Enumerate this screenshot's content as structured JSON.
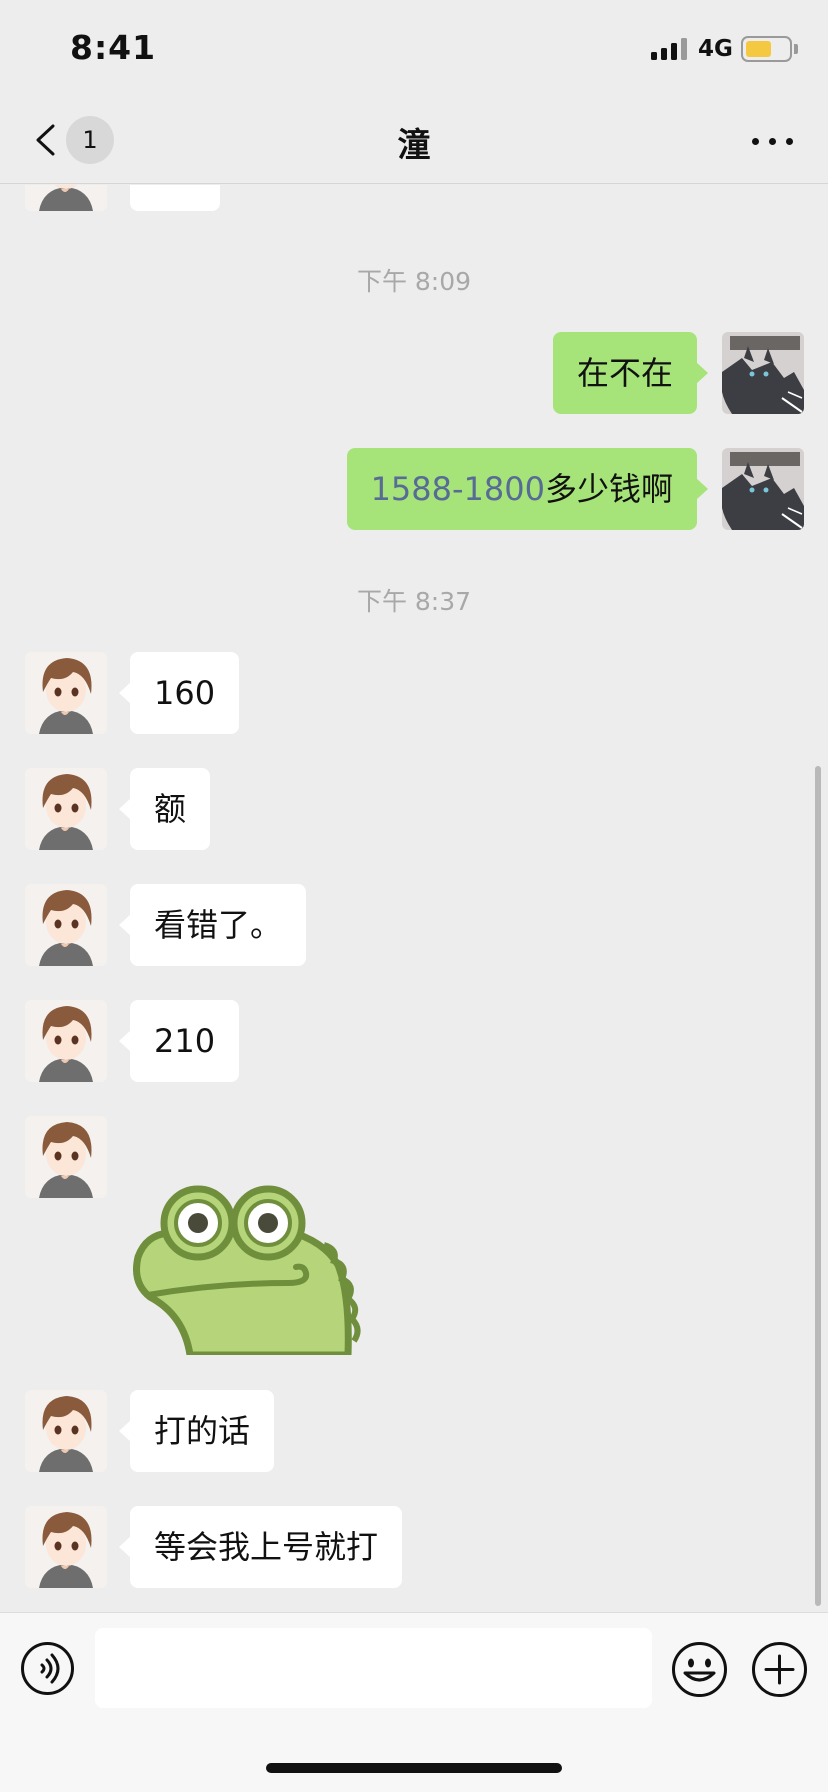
{
  "status_bar": {
    "time": "8:41",
    "network": "4G",
    "battery_color": "#f5c842",
    "battery_level": 0.6
  },
  "nav": {
    "back_badge": "1",
    "title": "潼",
    "more_icon": "ellipsis-icon"
  },
  "messages": {
    "time_1": "下午 8:09",
    "out_1": "在不在",
    "out_2_number": "1588-1800",
    "out_2_text": "多少钱啊",
    "time_2": "下午 8:37",
    "in_1": "160",
    "in_2": "额",
    "in_3": "看错了。",
    "in_4": "210",
    "in_5": "打的话",
    "in_6": "等会我上号就打"
  },
  "colors": {
    "bubble_out": "#a6e47a",
    "bubble_in": "#ffffff",
    "link": "#576b95",
    "background": "#ededed"
  },
  "input": {
    "placeholder": ""
  }
}
